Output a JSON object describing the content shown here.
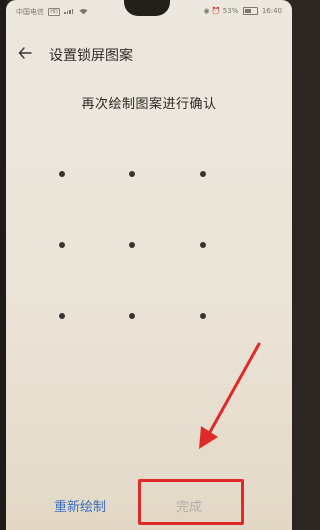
{
  "status_bar": {
    "carrier": "中国电信",
    "hd_badge": "HD",
    "battery_percent": "53%",
    "time": "16:40"
  },
  "header": {
    "back_icon": "arrow-left-icon",
    "title": "设置锁屏图案"
  },
  "prompt": "再次绘制图案进行确认",
  "pattern_grid": {
    "rows": 3,
    "cols": 3
  },
  "footer": {
    "redraw_label": "重新绘制",
    "done_label": "完成"
  },
  "annotation": {
    "color": "#e02a2a"
  }
}
